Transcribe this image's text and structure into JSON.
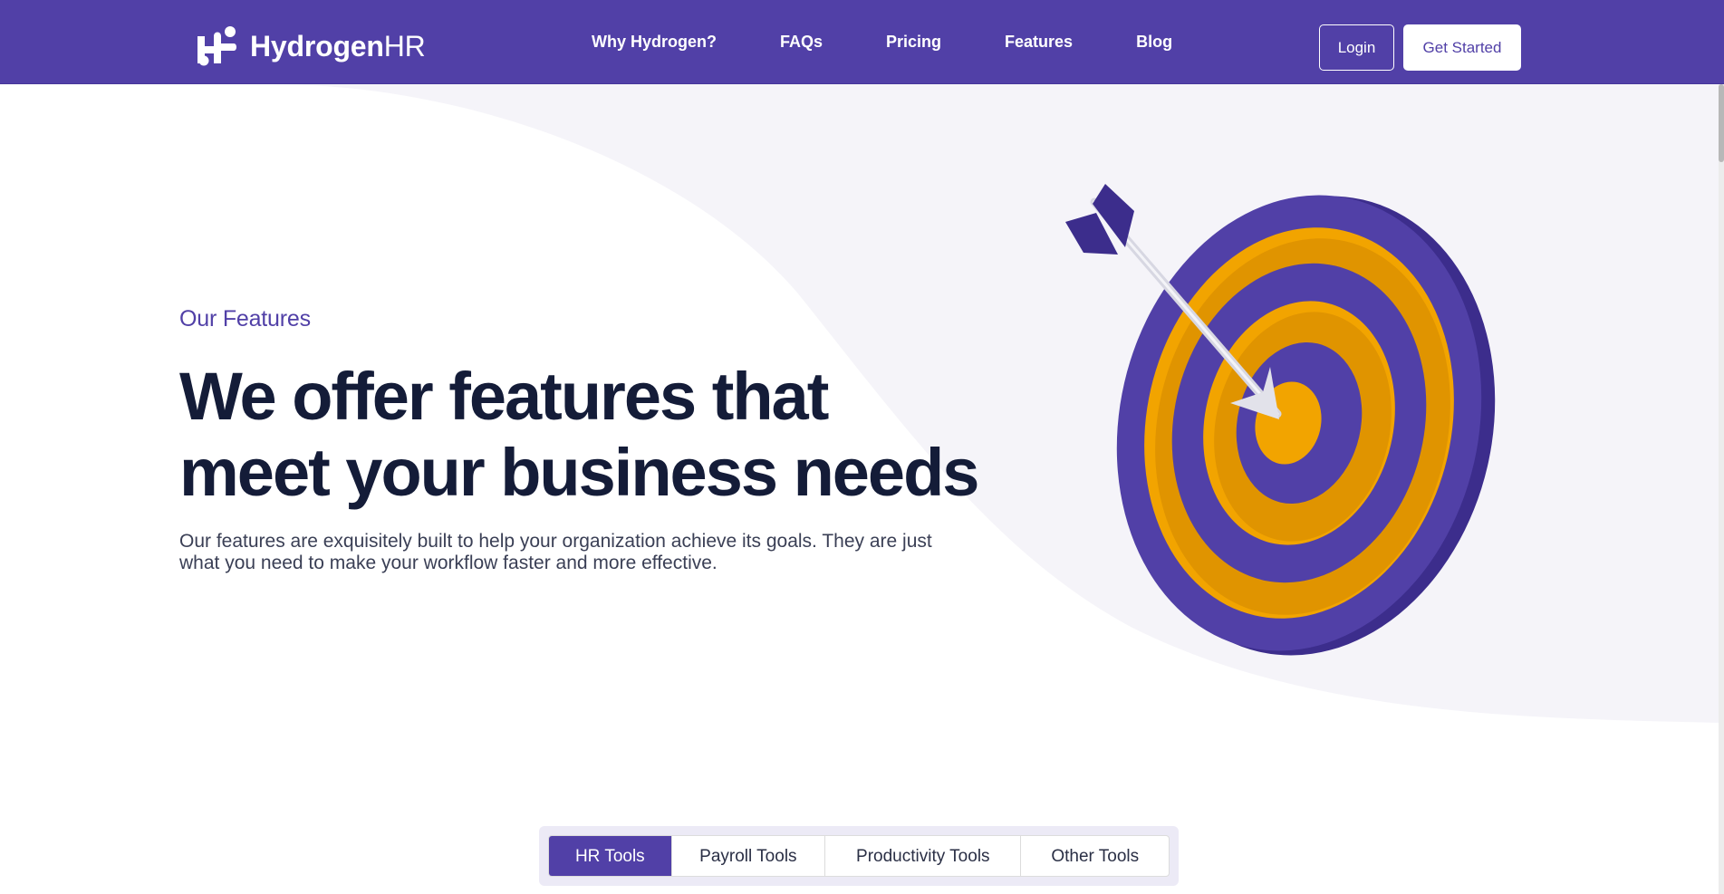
{
  "nav": {
    "brand_bold": "Hydrogen",
    "brand_light": "HR",
    "links": [
      "Why Hydrogen?",
      "FAQs",
      "Pricing",
      "Features",
      "Blog"
    ],
    "login_label": "Login",
    "get_started_label": "Get Started"
  },
  "hero": {
    "eyebrow": "Our Features",
    "headline_line1": "We offer features that",
    "headline_line2": "meet your business needs",
    "subtext_line1": "Our features are exquisitely built to help your organization achieve its goals. They are just",
    "subtext_line2": "what you need to make your workflow faster and more effective."
  },
  "tabs": {
    "items": [
      "HR Tools",
      "Payroll Tools",
      "Productivity Tools",
      "Other Tools"
    ],
    "active": "HR Tools"
  },
  "colors": {
    "brand_purple": "#5140a7",
    "target_orange": "#f2a400",
    "headline": "#141c38",
    "wave_bg": "#f5f4f9"
  },
  "icons": {
    "logo": "hydrogenhr-logo-icon",
    "illustration": "target-arrow-illustration"
  }
}
